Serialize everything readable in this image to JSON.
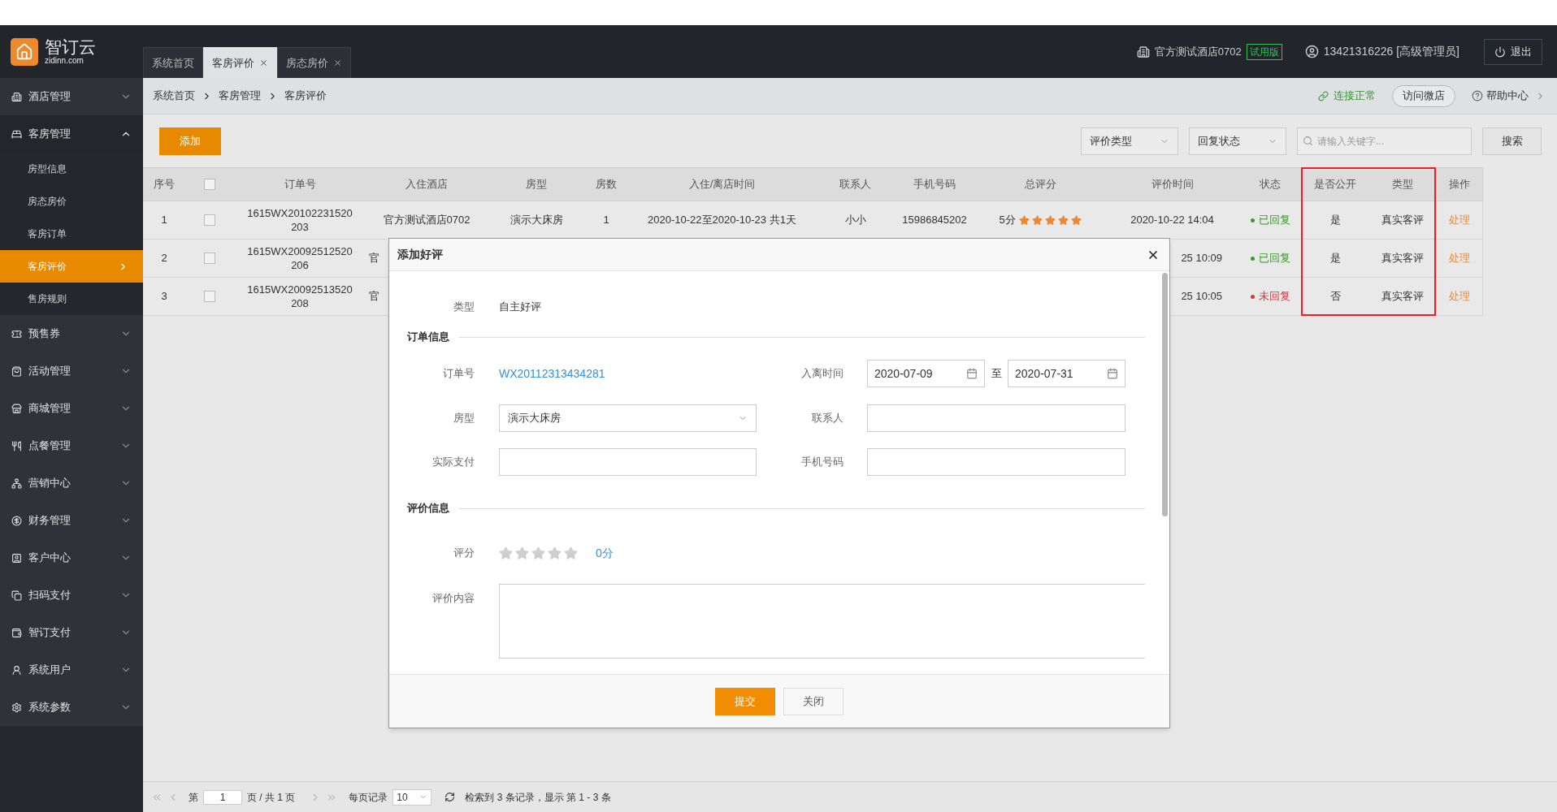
{
  "logo": {
    "name": "智订云",
    "domain": "zidinn.com"
  },
  "tabs": [
    {
      "label": "系统首页",
      "selected": false,
      "closable": false
    },
    {
      "label": "客房评价",
      "selected": true,
      "closable": true
    },
    {
      "label": "房态房价",
      "selected": false,
      "closable": true
    }
  ],
  "header": {
    "hotel": "官方测试酒店0702",
    "badge": "试用版",
    "user": "13421316226 [高级管理员]",
    "logout": "退出"
  },
  "sidebar": {
    "items": [
      {
        "label": "酒店管理",
        "expanded": false
      },
      {
        "label": "客房管理",
        "expanded": true,
        "children": [
          {
            "label": "房型信息",
            "selected": false
          },
          {
            "label": "房态房价",
            "selected": false
          },
          {
            "label": "客房订单",
            "selected": false
          },
          {
            "label": "客房评价",
            "selected": true
          },
          {
            "label": "售房规则",
            "selected": false
          }
        ]
      },
      {
        "label": "预售券",
        "expanded": false
      },
      {
        "label": "活动管理",
        "expanded": false
      },
      {
        "label": "商城管理",
        "expanded": false
      },
      {
        "label": "点餐管理",
        "expanded": false
      },
      {
        "label": "营销中心",
        "expanded": false
      },
      {
        "label": "财务管理",
        "expanded": false
      },
      {
        "label": "客户中心",
        "expanded": false
      },
      {
        "label": "扫码支付",
        "expanded": false
      },
      {
        "label": "智订支付",
        "expanded": false
      },
      {
        "label": "系统用户",
        "expanded": false
      },
      {
        "label": "系统参数",
        "expanded": false
      }
    ]
  },
  "breadcrumb": [
    "系统首页",
    "客房管理",
    "客房评价"
  ],
  "top_links": {
    "connection": "连接正常",
    "visit_shop": "访问微店",
    "help": "帮助中心"
  },
  "toolbar": {
    "add": "添加",
    "filters": [
      "评价类型",
      "回复状态"
    ],
    "search_placeholder": "请输入关键字...",
    "search": "搜索"
  },
  "table": {
    "header_checked": false,
    "columns": [
      "序号",
      "订单号",
      "入住酒店",
      "房型",
      "房数",
      "入住/离店时间",
      "联系人",
      "手机号码",
      "总评分",
      "评价时间",
      "状态",
      "是否公开",
      "类型",
      "操作"
    ],
    "rows": [
      {
        "index": "1",
        "checked": false,
        "order_no": "1615WX20102231520203",
        "hotel": "官方测试酒店0702",
        "room_type": "演示大床房",
        "rooms": "1",
        "stay": "2020-10-22至2020-10-23 共1天",
        "contact": "小小",
        "phone": "15986845202",
        "score": "5分",
        "stars": 5,
        "review_time": "2020-10-22 14:04",
        "status": "已回复",
        "replied": true,
        "public": "是",
        "type": "真实客评",
        "action": "处理"
      },
      {
        "index": "2",
        "checked": false,
        "order_no": "1615WX20092512520206",
        "hotel": "官",
        "review_time": "25 10:09",
        "status": "已回复",
        "replied": true,
        "public": "是",
        "type": "真实客评",
        "action": "处理"
      },
      {
        "index": "3",
        "checked": false,
        "order_no": "1615WX20092513520208",
        "hotel": "官",
        "review_time": "25 10:05",
        "status": "未回复",
        "replied": false,
        "public": "否",
        "type": "真实客评",
        "action": "处理"
      }
    ]
  },
  "dialog": {
    "title": "添加好评",
    "type": {
      "label": "类型",
      "value": "自主好评"
    },
    "order_section": "订单信息",
    "order_no": {
      "label": "订单号",
      "value": "WX20112313434281"
    },
    "stay": {
      "label": "入离时间",
      "from": "2020-07-09",
      "separator": "至",
      "to": "2020-07-31"
    },
    "room_type": {
      "label": "房型",
      "value": "演示大床房"
    },
    "contact": {
      "label": "联系人"
    },
    "paid": {
      "label": "实际支付"
    },
    "phone": {
      "label": "手机号码"
    },
    "review_section": "评价信息",
    "rating": {
      "label": "评分",
      "stars": 0,
      "reading": "0分"
    },
    "content": {
      "label": "评价内容"
    },
    "submit": "提交",
    "close": "关闭"
  },
  "pagination": {
    "page_prefix": "第",
    "page": "1",
    "page_suffix": "页 / 共 1 页",
    "per_page_label": "每页记录",
    "per_page": "10",
    "summary": "检索到 3 条记录，显示 第 1 - 3 条"
  }
}
